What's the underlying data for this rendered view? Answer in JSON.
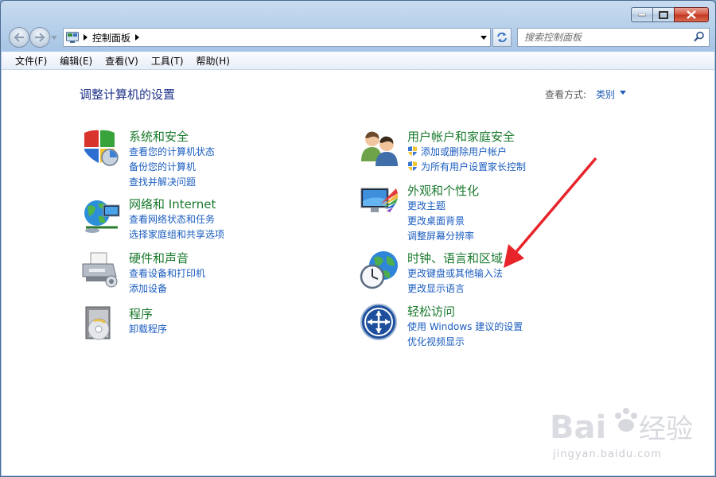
{
  "window": {
    "address": {
      "crumb": "控制面板"
    },
    "search": {
      "placeholder": "搜索控制面板"
    }
  },
  "menu": [
    "文件(F)",
    "编辑(E)",
    "查看(V)",
    "工具(T)",
    "帮助(H)"
  ],
  "page": {
    "title": "调整计算机的设置",
    "view_by_label": "查看方式:",
    "view_by_value": "类别"
  },
  "categories": [
    {
      "title": "系统和安全",
      "icon": "shield-icon",
      "links": [
        "查看您的计算机状态",
        "备份您的计算机",
        "查找并解决问题"
      ]
    },
    {
      "title": "网络和 Internet",
      "icon": "network-icon",
      "links": [
        "查看网络状态和任务",
        "选择家庭组和共享选项"
      ]
    },
    {
      "title": "硬件和声音",
      "icon": "printer-icon",
      "links": [
        "查看设备和打印机",
        "添加设备"
      ]
    },
    {
      "title": "程序",
      "icon": "programs-icon",
      "links": [
        "卸载程序"
      ]
    },
    {
      "title": "用户帐户和家庭安全",
      "icon": "users-icon",
      "links": [
        "添加或删除用户帐户",
        "为所有用户设置家长控制"
      ]
    },
    {
      "title": "外观和个性化",
      "icon": "appearance-icon",
      "links": [
        "更改主题",
        "更改桌面背景",
        "调整屏幕分辨率"
      ]
    },
    {
      "title": "时钟、语言和区域",
      "icon": "clock-globe-icon",
      "links": [
        "更改键盘或其他输入法",
        "更改显示语言"
      ]
    },
    {
      "title": "轻松访问",
      "icon": "ease-of-access-icon",
      "links": [
        "使用 Windows 建议的设置",
        "优化视频显示"
      ]
    }
  ],
  "watermark": {
    "logo": "Baidu经验",
    "url": "jingyan.baidu.com"
  },
  "colors": {
    "category_title": "#1a7a2d",
    "link": "#1a5cbf",
    "page_title": "#1e3287",
    "annotation_arrow": "#e8242b"
  }
}
